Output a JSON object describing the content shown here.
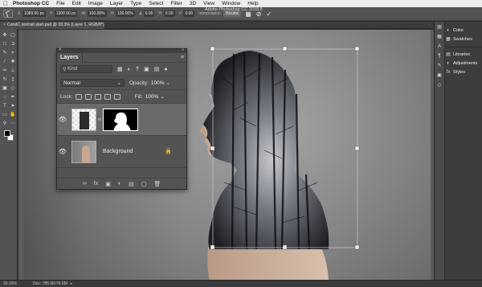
{
  "menubar": {
    "app": "Photoshop CC",
    "items": [
      "File",
      "Edit",
      "Image",
      "Layer",
      "Type",
      "Select",
      "Filter",
      "3D",
      "View",
      "Window",
      "Help"
    ]
  },
  "options": {
    "x_label": "X:",
    "x_value": "1089.50 px",
    "y_label": "Y:",
    "y_value": "1300.50 px",
    "w_label": "W:",
    "w_value": "100.00%",
    "h_label": "H:",
    "h_value": "100.00%",
    "angle_value": "0.00",
    "hskew_label": "H:",
    "hskew_value": "0.00",
    "vskew_label": "V:",
    "vskew_value": "0.00",
    "interp_label": "Interpolation:",
    "interp_value": "Bicubic",
    "window_title": "Adobe Photoshop CC 2018.8"
  },
  "document": {
    "tab_title": "CandC portrait start.psd @ 33.3% (Layer 1, RGB/8*)"
  },
  "layers_panel": {
    "title": "Layers",
    "kind_label": "Kind",
    "blend_mode": "Normal",
    "opacity_label": "Opacity:",
    "opacity_value": "100%",
    "lock_label": "Lock:",
    "fill_label": "Fill:",
    "fill_value": "100%",
    "layers": [
      {
        "name": "",
        "visible": true,
        "active": true
      },
      {
        "name": "Background",
        "visible": true,
        "active": false
      }
    ]
  },
  "right_panels": {
    "group1": [
      "Color",
      "Swatches"
    ],
    "group2": [
      "Libraries",
      "Adjustments",
      "Styles"
    ]
  },
  "status": {
    "zoom": "33.33%",
    "doc": "Doc: 785.0K/76.6M"
  }
}
